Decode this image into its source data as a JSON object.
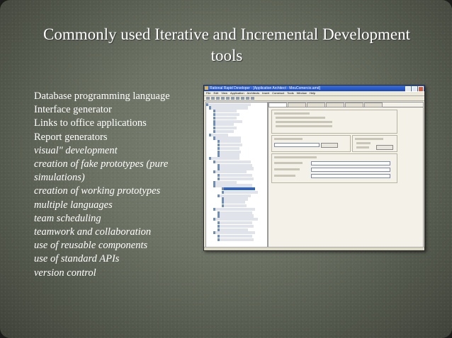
{
  "title": "Commonly used Iterative and Incremental Development tools",
  "bullets": [
    {
      "text": "Database programming language",
      "italic": false
    },
    {
      "text": "Interface generator",
      "italic": false
    },
    {
      "text": "Links to office applications",
      "italic": false
    },
    {
      "text": "Report generators",
      "italic": false
    },
    {
      "text": "visual\" development",
      "italic": true
    },
    {
      "text": "creation of fake prototypes (pure simulations)",
      "italic": true
    },
    {
      "text": "creation of working prototypes",
      "italic": true
    },
    {
      "text": "multiple languages",
      "italic": true
    },
    {
      "text": "team scheduling",
      "italic": true
    },
    {
      "text": "teamwork and collaboration",
      "italic": true
    },
    {
      "text": "use of reusable components",
      "italic": true
    },
    {
      "text": "use of standard APIs",
      "italic": true
    },
    {
      "text": "version control",
      "italic": true
    }
  ],
  "screenshot": {
    "window_title": "Rational Rapid Developer - [Application Architect - MeuComercio.amd]",
    "menu": [
      "File",
      "Edit",
      "View",
      "Application",
      "Architects",
      "Insert",
      "Construct",
      "Tools",
      "Window",
      "Help"
    ]
  },
  "colors": {
    "text": "#ffffff",
    "background": "#6c7264",
    "titlebar": "#1b48b8"
  }
}
